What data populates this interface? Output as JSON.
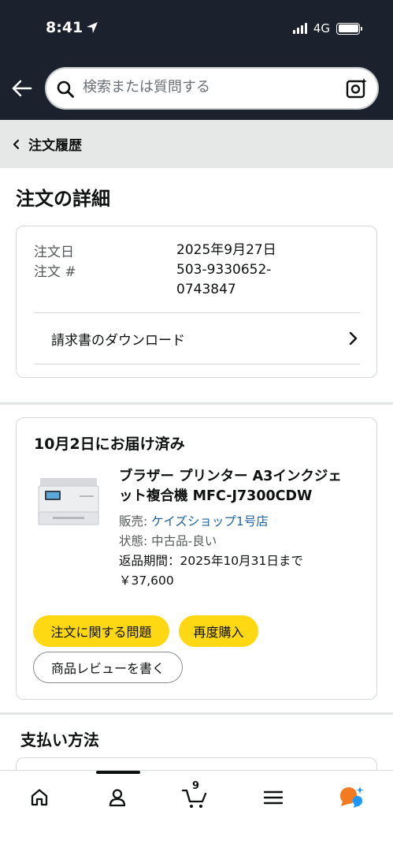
{
  "status_bar": {
    "time": "8:41",
    "network": "4G"
  },
  "header": {
    "search_placeholder": "検索または質問する"
  },
  "breadcrumb": {
    "label": "注文履歴"
  },
  "page": {
    "title": "注文の詳細"
  },
  "order_info": {
    "date_label": "注文日",
    "date_value": "2025年9月27日",
    "number_label": "注文 #",
    "number_value_line1": "503-9330652-",
    "number_value_line2": "0743847",
    "invoice_label": "請求書のダウンロード"
  },
  "shipment": {
    "status": "10月2日にお届け済み",
    "product": {
      "title": "ブラザー プリンター A3インクジェット複合機 MFC-J7300CDW",
      "seller_label": "販売:",
      "seller_name": "ケイズショップ1号店",
      "condition": "状態: 中古品-良い",
      "return_window": "返品期間：2025年10月31日まで",
      "price": "￥37,600"
    },
    "buttons": {
      "issue": "注文に関する問題",
      "rebuy": "再度購入",
      "review": "商品レビューを書く"
    }
  },
  "payment": {
    "title": "支払い方法"
  },
  "bottom_nav": {
    "cart_count": "9"
  },
  "colors": {
    "header_bg": "#1b222e",
    "accent_yellow": "#ffd814",
    "link": "#2162a1",
    "alexa": "#f47a20"
  }
}
